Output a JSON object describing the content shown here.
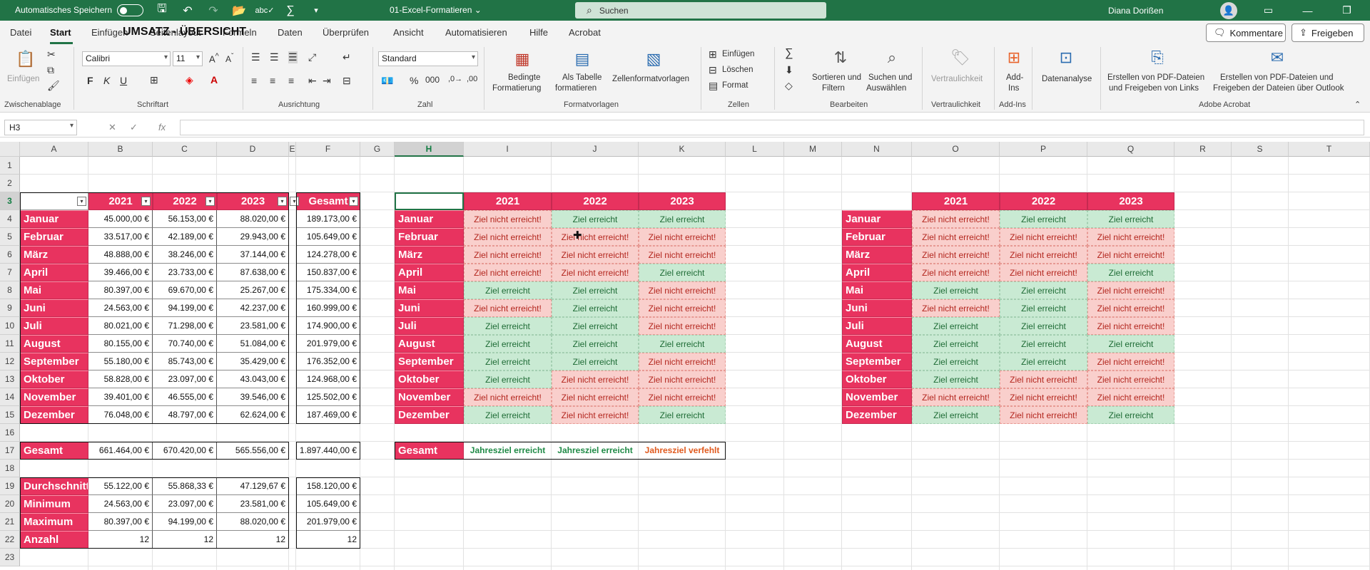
{
  "titlebar": {
    "autosave_label": "Automatisches Speichern",
    "doc_title": "01-Excel-Formatieren ⌄",
    "search_placeholder": "Suchen",
    "user_name": "Diana Dorißen"
  },
  "menu": {
    "tabs": [
      "Datei",
      "Start",
      "Einfügen",
      "Seitenlayout",
      "Formeln",
      "Daten",
      "Überprüfen",
      "Ansicht",
      "Automatisieren",
      "Hilfe",
      "Acrobat"
    ],
    "comments_label": "Kommentare",
    "share_label": "Freigeben"
  },
  "ribbon": {
    "clipboard": {
      "paste_label": "Einfügen",
      "group_label": "Zwischenablage"
    },
    "font": {
      "font_name": "Calibri",
      "font_size": "11",
      "group_label": "Schriftart"
    },
    "alignment": {
      "group_label": "Ausrichtung"
    },
    "number": {
      "format": "Standard",
      "group_label": "Zahl"
    },
    "styles": {
      "conditional_label_1": "Bedingte",
      "conditional_label_2": "Formatierung",
      "as_table_label_1": "Als Tabelle",
      "as_table_label_2": "formatieren",
      "cell_styles_label": "Zellenformatvorlagen",
      "group_label": "Formatvorlagen"
    },
    "cells": {
      "insert": "Einfügen",
      "delete": "Löschen",
      "format": "Format",
      "group_label": "Zellen"
    },
    "editing": {
      "sort_label_1": "Sortieren und",
      "sort_label_2": "Filtern",
      "find_label_1": "Suchen und",
      "find_label_2": "Auswählen",
      "group_label": "Bearbeiten"
    },
    "sensitivity": {
      "label": "Vertraulichkeit",
      "group_label": "Vertraulichkeit"
    },
    "addins": {
      "label_1": "Add-",
      "label_2": "Ins",
      "group_label": "Add-Ins"
    },
    "analysis": {
      "label": "Datenanalyse"
    },
    "acrobat": {
      "pdf_link_1": "Erstellen von PDF-Dateien",
      "pdf_link_2": "und Freigeben von Links",
      "pdf_outlook_1": "Erstellen von PDF-Dateien und",
      "pdf_outlook_2": "Freigeben der Dateien über Outlook",
      "group_label": "Adobe Acrobat"
    }
  },
  "formula_bar": {
    "name_box": "H3",
    "fx": "fx",
    "formula": ""
  },
  "columns": [
    "A",
    "B",
    "C",
    "D",
    "E",
    "F",
    "G",
    "H",
    "I",
    "J",
    "K",
    "L",
    "M",
    "N",
    "O",
    "P",
    "Q",
    "R",
    "S",
    "T"
  ],
  "rows": [
    "1",
    "2",
    "3",
    "4",
    "5",
    "6",
    "7",
    "8",
    "9",
    "10",
    "11",
    "12",
    "13",
    "14",
    "15",
    "16",
    "17",
    "18",
    "19",
    "20",
    "21",
    "22",
    "23"
  ],
  "sheet": {
    "title": "UMSATZ - ÜBERSICHT",
    "years": [
      "2021",
      "2022",
      "2023"
    ],
    "total_header": "Gesamt",
    "months": [
      "Januar",
      "Februar",
      "März",
      "April",
      "Mai",
      "Juni",
      "Juli",
      "August",
      "September",
      "Oktober",
      "November",
      "Dezember"
    ],
    "revenue": [
      [
        "45.000,00 €",
        "56.153,00 €",
        "88.020,00 €",
        "189.173,00 €"
      ],
      [
        "33.517,00 €",
        "42.189,00 €",
        "29.943,00 €",
        "105.649,00 €"
      ],
      [
        "48.888,00 €",
        "38.246,00 €",
        "37.144,00 €",
        "124.278,00 €"
      ],
      [
        "39.466,00 €",
        "23.733,00 €",
        "87.638,00 €",
        "150.837,00 €"
      ],
      [
        "80.397,00 €",
        "69.670,00 €",
        "25.267,00 €",
        "175.334,00 €"
      ],
      [
        "24.563,00 €",
        "94.199,00 €",
        "42.237,00 €",
        "160.999,00 €"
      ],
      [
        "80.021,00 €",
        "71.298,00 €",
        "23.581,00 €",
        "174.900,00 €"
      ],
      [
        "80.155,00 €",
        "70.740,00 €",
        "51.084,00 €",
        "201.979,00 €"
      ],
      [
        "55.180,00 €",
        "85.743,00 €",
        "35.429,00 €",
        "176.352,00 €"
      ],
      [
        "58.828,00 €",
        "23.097,00 €",
        "43.043,00 €",
        "124.968,00 €"
      ],
      [
        "39.401,00 €",
        "46.555,00 €",
        "39.546,00 €",
        "125.502,00 €"
      ],
      [
        "76.048,00 €",
        "48.797,00 €",
        "62.624,00 €",
        "187.469,00 €"
      ]
    ],
    "totals": {
      "label": "Gesamt",
      "values": [
        "661.464,00 €",
        "670.420,00 €",
        "565.556,00 €",
        "1.897.440,00 €"
      ]
    },
    "stats": [
      {
        "label": "Durchschnitt",
        "values": [
          "55.122,00 €",
          "55.868,33 €",
          "47.129,67 €",
          "158.120,00 €"
        ]
      },
      {
        "label": "Minimum",
        "values": [
          "24.563,00 €",
          "23.097,00 €",
          "23.581,00 €",
          "105.649,00 €"
        ]
      },
      {
        "label": "Maximum",
        "values": [
          "80.397,00 €",
          "94.199,00 €",
          "88.020,00 €",
          "201.979,00 €"
        ]
      },
      {
        "label": "Anzahl",
        "values": [
          "12",
          "12",
          "12",
          "12"
        ]
      }
    ],
    "status_yes": "Ziel erreicht",
    "status_no": "Ziel nicht erreicht!",
    "status_middle": [
      [
        0,
        1,
        1
      ],
      [
        0,
        0,
        0
      ],
      [
        0,
        0,
        0
      ],
      [
        0,
        0,
        1
      ],
      [
        1,
        1,
        0
      ],
      [
        0,
        1,
        0
      ],
      [
        1,
        1,
        0
      ],
      [
        1,
        1,
        1
      ],
      [
        1,
        1,
        0
      ],
      [
        1,
        0,
        0
      ],
      [
        0,
        0,
        0
      ],
      [
        1,
        0,
        1
      ]
    ],
    "status_right": [
      [
        0,
        1,
        1
      ],
      [
        0,
        0,
        0
      ],
      [
        0,
        0,
        0
      ],
      [
        0,
        0,
        1
      ],
      [
        1,
        1,
        0
      ],
      [
        0,
        1,
        0
      ],
      [
        1,
        1,
        0
      ],
      [
        1,
        1,
        1
      ],
      [
        1,
        1,
        0
      ],
      [
        1,
        0,
        0
      ],
      [
        0,
        0,
        0
      ],
      [
        1,
        0,
        1
      ]
    ],
    "year_goal_label": "Gesamt",
    "year_goal": [
      "Jahresziel erreicht",
      "Jahresziel erreicht",
      "Jahresziel verfehlt"
    ],
    "year_goal_ok": [
      1,
      1,
      0
    ]
  },
  "colors": {
    "excel_green": "#217346",
    "pink": "#e8335f",
    "bad_fill": "#f9cfcc",
    "good_fill": "#c9ead3"
  },
  "icons": [
    "save-icon",
    "undo-icon",
    "redo-icon",
    "open-icon",
    "spelling-icon",
    "sum-icon",
    "search-icon",
    "paste-icon",
    "cut-icon",
    "copy-icon",
    "format-painter-icon",
    "bold-icon",
    "italic-icon",
    "underline-icon",
    "borders-icon",
    "fill-color-icon",
    "font-color-icon",
    "percent-icon",
    "conditional-format-icon",
    "table-icon",
    "cell-styles-icon",
    "sort-filter-icon",
    "find-icon",
    "addins-icon",
    "data-analysis-icon",
    "pdf-icon"
  ]
}
